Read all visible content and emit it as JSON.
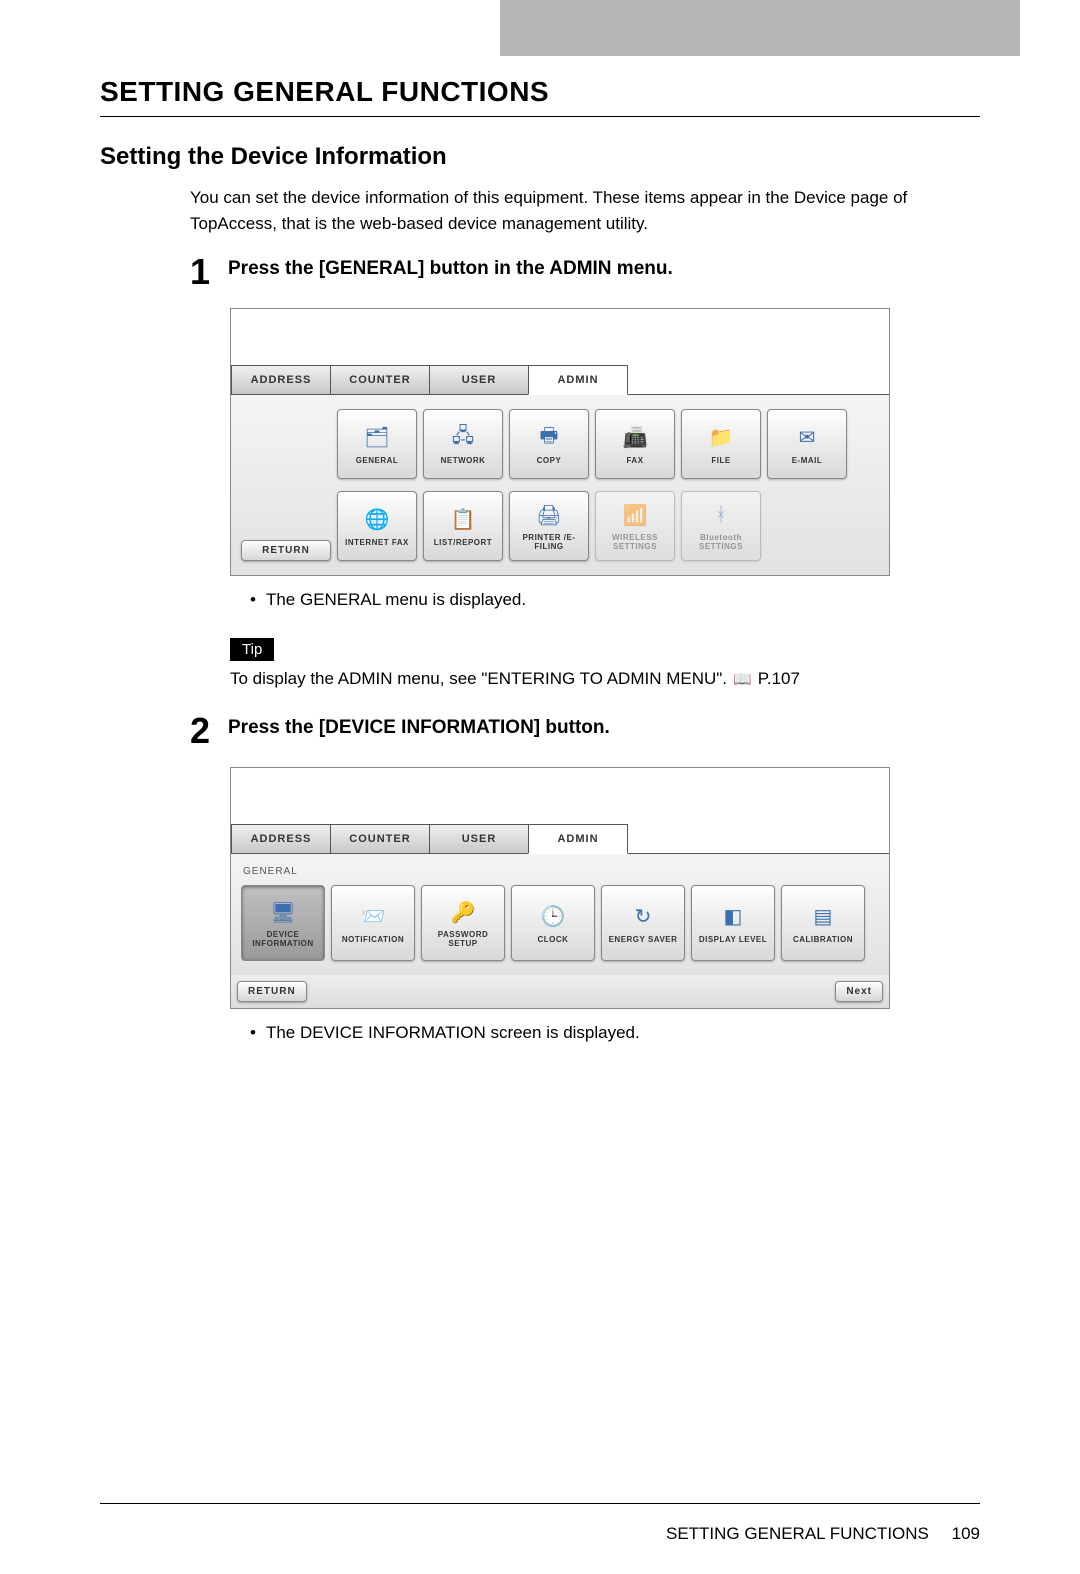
{
  "page": {
    "section_title": "SETTING GENERAL FUNCTIONS",
    "subsection": "Setting the Device Information",
    "intro": "You can set the device information of this equipment.  These items appear in the Device page of TopAccess, that is the web-based device management utility.",
    "footer_label": "SETTING GENERAL FUNCTIONS",
    "footer_page": "109"
  },
  "step1": {
    "num": "1",
    "title": "Press the [GENERAL] button in the ADMIN menu.",
    "bullet": "The GENERAL menu is displayed.",
    "tip_label": "Tip",
    "tip_text": "To display the ADMIN menu, see \"ENTERING TO ADMIN MENU\".",
    "tip_ref": "P.107",
    "screen": {
      "tabs": [
        "ADDRESS",
        "COUNTER",
        "USER",
        "ADMIN"
      ],
      "return": "RETURN",
      "row1": [
        {
          "label": "GENERAL",
          "icon": "general-icon"
        },
        {
          "label": "NETWORK",
          "icon": "network-icon"
        },
        {
          "label": "COPY",
          "icon": "copy-icon"
        },
        {
          "label": "FAX",
          "icon": "fax-icon"
        },
        {
          "label": "FILE",
          "icon": "file-icon"
        },
        {
          "label": "E-MAIL",
          "icon": "email-icon"
        }
      ],
      "row2": [
        {
          "label": "INTERNET FAX",
          "icon": "ifax-icon"
        },
        {
          "label": "LIST/REPORT",
          "icon": "list-icon"
        },
        {
          "label": "PRINTER\n/E-FILING",
          "icon": "printer-icon"
        },
        {
          "label": "WIRELESS\nSETTINGS",
          "icon": "wifi-icon",
          "disabled": true
        },
        {
          "label": "Bluetooth\nSETTINGS",
          "icon": "bt-icon",
          "disabled": true
        }
      ]
    }
  },
  "step2": {
    "num": "2",
    "title": "Press the [DEVICE INFORMATION] button.",
    "bullet": "The DEVICE INFORMATION screen is displayed.",
    "screen": {
      "tabs": [
        "ADDRESS",
        "COUNTER",
        "USER",
        "ADMIN"
      ],
      "sub": "GENERAL",
      "return": "RETURN",
      "next": "Next",
      "row": [
        {
          "label": "DEVICE\nINFORMATION",
          "icon": "device-icon"
        },
        {
          "label": "NOTIFICATION",
          "icon": "notify-icon"
        },
        {
          "label": "PASSWORD SETUP",
          "icon": "pwd-icon"
        },
        {
          "label": "CLOCK",
          "icon": "clock-icon"
        },
        {
          "label": "ENERGY\nSAVER",
          "icon": "energy-icon"
        },
        {
          "label": "DISPLAY LEVEL",
          "icon": "display-icon"
        },
        {
          "label": "CALIBRATION",
          "icon": "calib-icon"
        }
      ]
    }
  }
}
